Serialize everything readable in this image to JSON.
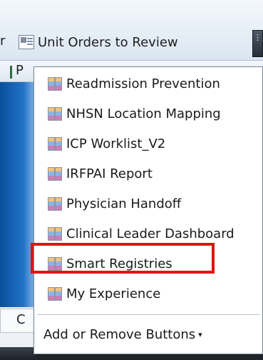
{
  "toolbar": {
    "cut_text": "r",
    "button_label": "Unit Orders to Review",
    "overflow_glyph": "⋮"
  },
  "strip2": {
    "cut_label": "P"
  },
  "bottom": {
    "cut_label": "C"
  },
  "menu": {
    "items": [
      {
        "label": "Readmission Prevention"
      },
      {
        "label": "NHSN Location Mapping"
      },
      {
        "label": "ICP Worklist_V2"
      },
      {
        "label": "IRFPAI Report"
      },
      {
        "label": "Physician Handoff"
      },
      {
        "label": "Clinical Leader Dashboard"
      },
      {
        "label": "Smart Registries",
        "highlighted": true
      },
      {
        "label": "My Experience"
      }
    ],
    "footer_label": "Add or Remove Buttons",
    "footer_caret": "▾"
  },
  "colors": {
    "highlight": "#e01414",
    "panel_blue": "#0b4f9c"
  }
}
